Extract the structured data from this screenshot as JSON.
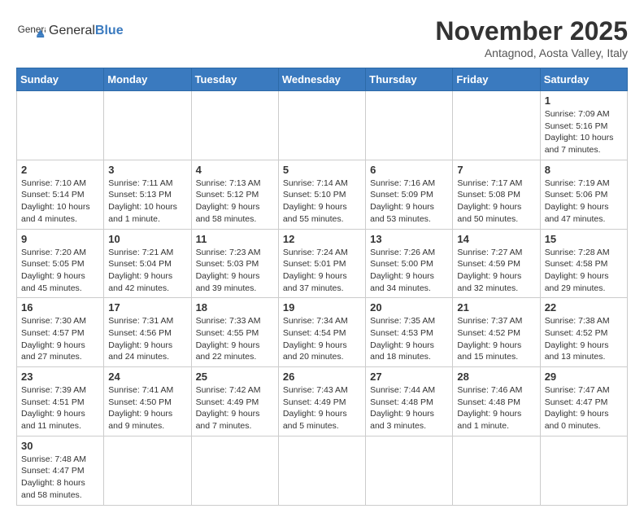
{
  "header": {
    "logo_general": "General",
    "logo_blue": "Blue",
    "month_title": "November 2025",
    "subtitle": "Antagnod, Aosta Valley, Italy"
  },
  "weekdays": [
    "Sunday",
    "Monday",
    "Tuesday",
    "Wednesday",
    "Thursday",
    "Friday",
    "Saturday"
  ],
  "weeks": [
    [
      {
        "day": "",
        "info": ""
      },
      {
        "day": "",
        "info": ""
      },
      {
        "day": "",
        "info": ""
      },
      {
        "day": "",
        "info": ""
      },
      {
        "day": "",
        "info": ""
      },
      {
        "day": "",
        "info": ""
      },
      {
        "day": "1",
        "info": "Sunrise: 7:09 AM\nSunset: 5:16 PM\nDaylight: 10 hours and 7 minutes."
      }
    ],
    [
      {
        "day": "2",
        "info": "Sunrise: 7:10 AM\nSunset: 5:14 PM\nDaylight: 10 hours and 4 minutes."
      },
      {
        "day": "3",
        "info": "Sunrise: 7:11 AM\nSunset: 5:13 PM\nDaylight: 10 hours and 1 minute."
      },
      {
        "day": "4",
        "info": "Sunrise: 7:13 AM\nSunset: 5:12 PM\nDaylight: 9 hours and 58 minutes."
      },
      {
        "day": "5",
        "info": "Sunrise: 7:14 AM\nSunset: 5:10 PM\nDaylight: 9 hours and 55 minutes."
      },
      {
        "day": "6",
        "info": "Sunrise: 7:16 AM\nSunset: 5:09 PM\nDaylight: 9 hours and 53 minutes."
      },
      {
        "day": "7",
        "info": "Sunrise: 7:17 AM\nSunset: 5:08 PM\nDaylight: 9 hours and 50 minutes."
      },
      {
        "day": "8",
        "info": "Sunrise: 7:19 AM\nSunset: 5:06 PM\nDaylight: 9 hours and 47 minutes."
      }
    ],
    [
      {
        "day": "9",
        "info": "Sunrise: 7:20 AM\nSunset: 5:05 PM\nDaylight: 9 hours and 45 minutes."
      },
      {
        "day": "10",
        "info": "Sunrise: 7:21 AM\nSunset: 5:04 PM\nDaylight: 9 hours and 42 minutes."
      },
      {
        "day": "11",
        "info": "Sunrise: 7:23 AM\nSunset: 5:03 PM\nDaylight: 9 hours and 39 minutes."
      },
      {
        "day": "12",
        "info": "Sunrise: 7:24 AM\nSunset: 5:01 PM\nDaylight: 9 hours and 37 minutes."
      },
      {
        "day": "13",
        "info": "Sunrise: 7:26 AM\nSunset: 5:00 PM\nDaylight: 9 hours and 34 minutes."
      },
      {
        "day": "14",
        "info": "Sunrise: 7:27 AM\nSunset: 4:59 PM\nDaylight: 9 hours and 32 minutes."
      },
      {
        "day": "15",
        "info": "Sunrise: 7:28 AM\nSunset: 4:58 PM\nDaylight: 9 hours and 29 minutes."
      }
    ],
    [
      {
        "day": "16",
        "info": "Sunrise: 7:30 AM\nSunset: 4:57 PM\nDaylight: 9 hours and 27 minutes."
      },
      {
        "day": "17",
        "info": "Sunrise: 7:31 AM\nSunset: 4:56 PM\nDaylight: 9 hours and 24 minutes."
      },
      {
        "day": "18",
        "info": "Sunrise: 7:33 AM\nSunset: 4:55 PM\nDaylight: 9 hours and 22 minutes."
      },
      {
        "day": "19",
        "info": "Sunrise: 7:34 AM\nSunset: 4:54 PM\nDaylight: 9 hours and 20 minutes."
      },
      {
        "day": "20",
        "info": "Sunrise: 7:35 AM\nSunset: 4:53 PM\nDaylight: 9 hours and 18 minutes."
      },
      {
        "day": "21",
        "info": "Sunrise: 7:37 AM\nSunset: 4:52 PM\nDaylight: 9 hours and 15 minutes."
      },
      {
        "day": "22",
        "info": "Sunrise: 7:38 AM\nSunset: 4:52 PM\nDaylight: 9 hours and 13 minutes."
      }
    ],
    [
      {
        "day": "23",
        "info": "Sunrise: 7:39 AM\nSunset: 4:51 PM\nDaylight: 9 hours and 11 minutes."
      },
      {
        "day": "24",
        "info": "Sunrise: 7:41 AM\nSunset: 4:50 PM\nDaylight: 9 hours and 9 minutes."
      },
      {
        "day": "25",
        "info": "Sunrise: 7:42 AM\nSunset: 4:49 PM\nDaylight: 9 hours and 7 minutes."
      },
      {
        "day": "26",
        "info": "Sunrise: 7:43 AM\nSunset: 4:49 PM\nDaylight: 9 hours and 5 minutes."
      },
      {
        "day": "27",
        "info": "Sunrise: 7:44 AM\nSunset: 4:48 PM\nDaylight: 9 hours and 3 minutes."
      },
      {
        "day": "28",
        "info": "Sunrise: 7:46 AM\nSunset: 4:48 PM\nDaylight: 9 hours and 1 minute."
      },
      {
        "day": "29",
        "info": "Sunrise: 7:47 AM\nSunset: 4:47 PM\nDaylight: 9 hours and 0 minutes."
      }
    ],
    [
      {
        "day": "30",
        "info": "Sunrise: 7:48 AM\nSunset: 4:47 PM\nDaylight: 8 hours and 58 minutes."
      },
      {
        "day": "",
        "info": ""
      },
      {
        "day": "",
        "info": ""
      },
      {
        "day": "",
        "info": ""
      },
      {
        "day": "",
        "info": ""
      },
      {
        "day": "",
        "info": ""
      },
      {
        "day": "",
        "info": ""
      }
    ]
  ]
}
